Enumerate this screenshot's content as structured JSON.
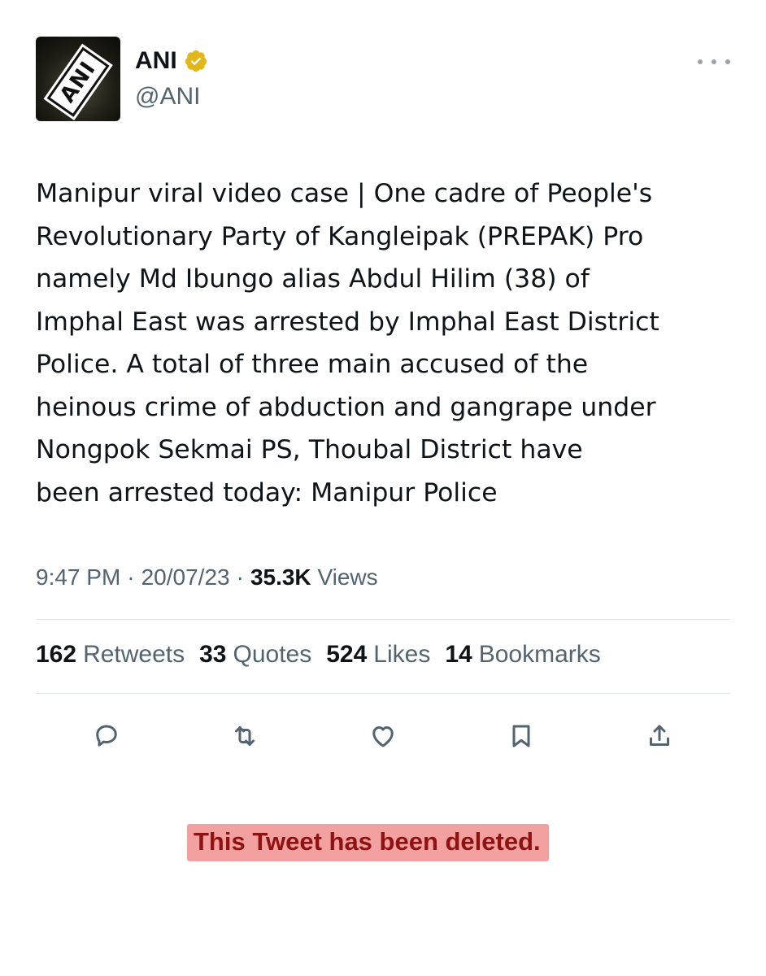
{
  "author": {
    "name": "ANI",
    "handle": "@ANI",
    "avatar_logo_text": "ANI",
    "verified_color": "#e2b719"
  },
  "tweet": {
    "text": "Manipur viral video case | One cadre of People's\nRevolutionary Party of Kangleipak (PREPAK) Pro\nnamely Md Ibungo alias Abdul Hilim (38) of\nImphal East was arrested by Imphal East District\nPolice. A total of three main accused of the\nheinous crime of abduction and gangrape under\nNongpok Sekmai PS, Thoubal District have\nbeen arrested today: Manipur Police",
    "time": "9:47 PM",
    "date": "20/07/23",
    "views_count": "35.3K",
    "views_label": "Views",
    "separator": "·"
  },
  "stats": {
    "retweets_count": "162",
    "retweets_label": "Retweets",
    "quotes_count": "33",
    "quotes_label": "Quotes",
    "likes_count": "524",
    "likes_label": "Likes",
    "bookmarks_count": "14",
    "bookmarks_label": "Bookmarks"
  },
  "actions": {
    "icons": [
      "reply-icon",
      "retweet-icon",
      "like-icon",
      "bookmark-icon",
      "share-icon"
    ]
  },
  "notice": {
    "text": "This Tweet has been deleted.",
    "highlight_color": "#f3a0a0",
    "text_color": "#8f1212"
  }
}
